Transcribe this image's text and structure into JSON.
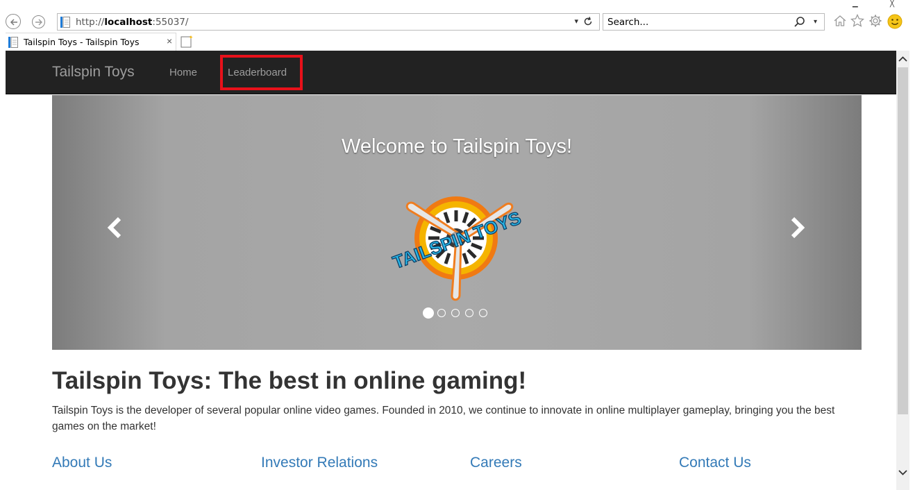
{
  "browser": {
    "url_prefix": "http://",
    "url_host": "localhost",
    "url_suffix": ":55037/",
    "search_placeholder": "Search...",
    "tab_title": "Tailspin Toys - Tailspin Toys",
    "tab_close": "×",
    "icons": [
      "back-icon",
      "forward-icon",
      "page-icon",
      "refresh-icon",
      "search-icon",
      "home-icon",
      "star-icon",
      "gear-icon",
      "smiley-icon",
      "new-tab-icon"
    ]
  },
  "navbar": {
    "brand": "Tailspin Toys",
    "items": [
      "Home",
      "Leaderboard"
    ],
    "highlight_color": "#e8111a"
  },
  "carousel": {
    "caption": "Welcome to Tailspin Toys!",
    "logo_text": "TAILSPIN TOYS",
    "slide_count": 5,
    "active_slide": 1
  },
  "main": {
    "headline": "Tailspin Toys: The best in online gaming!",
    "intro": "Tailspin Toys is the developer of several popular online video games. Founded in 2010, we continue to innovate in online multiplayer gameplay, bringing you the best games on the market!",
    "links": [
      "About Us",
      "Investor Relations",
      "Careers",
      "Contact Us"
    ]
  },
  "colors": {
    "navbar_bg": "#222222",
    "nav_text": "#9d9d9d",
    "link": "#337ab7",
    "body_text": "#333333"
  }
}
